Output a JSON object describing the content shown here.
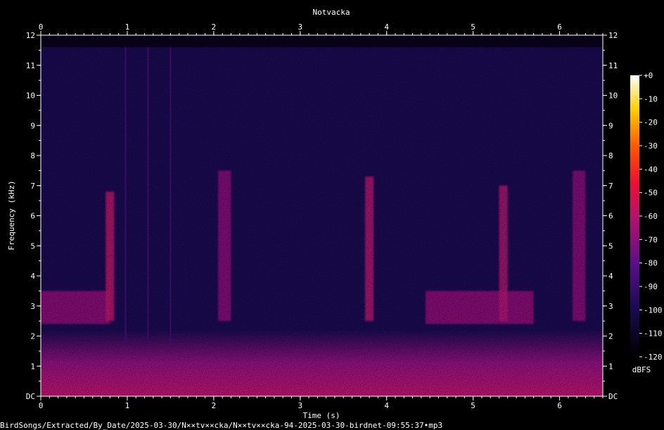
{
  "chart_data": {
    "type": "heatmap",
    "title": "Notvacka",
    "xlabel": "Time (s)",
    "ylabel": "Frequency (kHz)",
    "xlim": [
      0,
      6.5
    ],
    "ylim": [
      0,
      12
    ],
    "x_ticks": [
      "0",
      "1",
      "2",
      "3",
      "4",
      "5",
      "6"
    ],
    "y_ticks": [
      "DC",
      "1",
      "2",
      "3",
      "4",
      "5",
      "6",
      "7",
      "8",
      "9",
      "10",
      "11",
      "12"
    ],
    "colorbar": {
      "label": "dBFS",
      "ticks": [
        "+0",
        "-10",
        "-20",
        "-30",
        "-40",
        "-50",
        "-60",
        "-70",
        "-80",
        "-90",
        "-100",
        "-110",
        "-120"
      ],
      "range": [
        -120,
        0
      ]
    },
    "upper_cutoff_khz": 11.6,
    "background_level_dbfs": -100,
    "low_freq_band": {
      "top_khz": 2.2,
      "level_dbfs": -60
    },
    "call_segments": [
      {
        "t_start": 0.0,
        "t_end": 0.8,
        "f_low": 2.4,
        "f_high": 3.5,
        "level_dbfs": -68
      },
      {
        "t_start": 0.75,
        "t_end": 0.85,
        "f_low": 2.5,
        "f_high": 6.8,
        "level_dbfs": -60
      },
      {
        "t_start": 2.05,
        "t_end": 2.2,
        "f_low": 2.5,
        "f_high": 7.5,
        "level_dbfs": -70
      },
      {
        "t_start": 3.75,
        "t_end": 3.85,
        "f_low": 2.5,
        "f_high": 7.3,
        "level_dbfs": -62
      },
      {
        "t_start": 4.45,
        "t_end": 5.7,
        "f_low": 2.4,
        "f_high": 3.5,
        "level_dbfs": -68
      },
      {
        "t_start": 5.3,
        "t_end": 5.4,
        "f_low": 2.5,
        "f_high": 7.0,
        "level_dbfs": -63
      },
      {
        "t_start": 6.15,
        "t_end": 6.3,
        "f_low": 2.5,
        "f_high": 7.5,
        "level_dbfs": -70
      }
    ],
    "click_lines_s": [
      0.98,
      1.24,
      1.5
    ]
  },
  "footer": {
    "file_path": "BirdSongs/Extracted/By_Date/2025-03-30/N××tv××cka/N××tv××cka-94-2025-03-30-birdnet-09:55:37•mp3"
  }
}
